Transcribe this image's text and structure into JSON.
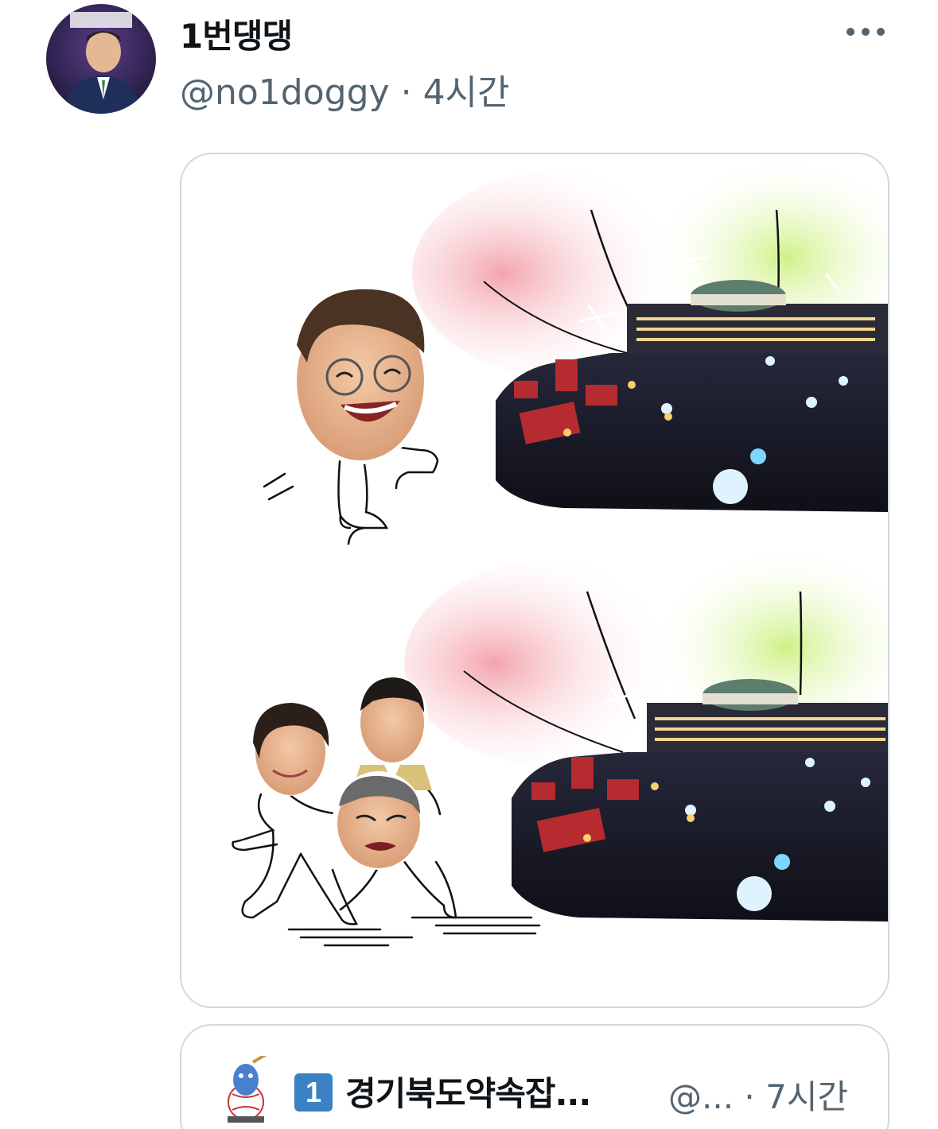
{
  "tweet": {
    "display_name": "1번댕댕",
    "handle": "@no1doggy",
    "separator": "·",
    "time": "4시간"
  },
  "icons": {
    "more": "more-horizontal-icon",
    "avatar": "profile-avatar",
    "verified_number": "keycap-1-icon"
  },
  "quoted_tweet": {
    "badge": "1",
    "display_name": "경기북도약속잡...",
    "handle": "@...",
    "separator": "·",
    "time": "7시간"
  },
  "colors": {
    "secondary_text": "#536471",
    "border": "#cfd9de",
    "badge_blue": "#3b82c4"
  }
}
